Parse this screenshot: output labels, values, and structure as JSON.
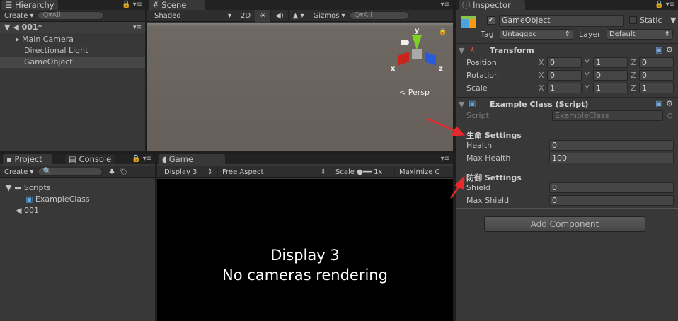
{
  "hierarchy": {
    "tab": "Hierarchy",
    "create": "Create ▾",
    "search": "Q▾All",
    "scene": "001*",
    "items": [
      "Main Camera",
      "Directional Light",
      "GameObject"
    ]
  },
  "scene": {
    "tab": "Scene",
    "shading": "Shaded",
    "mode2d": "2D",
    "gizmos": "Gizmos ▾",
    "search": "Q▾All",
    "persp": "< Persp",
    "axes": {
      "x": "x",
      "y": "y",
      "z": "z"
    }
  },
  "project": {
    "tabs": [
      "Project",
      "Console"
    ],
    "create": "Create ▾",
    "tree": [
      {
        "label": "Scripts"
      },
      {
        "label": "ExampleClass"
      },
      {
        "label": "001"
      }
    ]
  },
  "game": {
    "tab": "Game",
    "display": "Display 3",
    "aspect": "Free Aspect",
    "scale_label": "Scale",
    "scale_value": "1x",
    "maximize": "Maximize C",
    "message_line1": "Display 3",
    "message_line2": "No cameras rendering"
  },
  "inspector": {
    "tab": "Inspector",
    "object_name": "GameObject",
    "static": "Static",
    "tag_label": "Tag",
    "tag": "Untagged",
    "layer_label": "Layer",
    "layer": "Default",
    "transform": {
      "title": "Transform",
      "rows": [
        {
          "label": "Position",
          "x": "0",
          "y": "1",
          "z": "0"
        },
        {
          "label": "Rotation",
          "x": "0",
          "y": "0",
          "z": "0"
        },
        {
          "label": "Scale",
          "x": "1",
          "y": "1",
          "z": "1"
        }
      ],
      "axis_x": "X",
      "axis_y": "Y",
      "axis_z": "Z"
    },
    "script": {
      "title": "Example Class (Script)",
      "script_label": "Script",
      "script_value": "ExampleClass",
      "header1": "生命 Settings",
      "health_label": "Health",
      "health": "0",
      "max_health_label": "Max Health",
      "max_health": "100",
      "header2": "防御 Settings",
      "shield_label": "Shield",
      "shield": "0",
      "max_shield_label": "Max Shield",
      "max_shield": "0"
    },
    "add_component": "Add Component"
  },
  "colors": {
    "accent_arrow": "#e8282a",
    "selection": "#4a4a4a"
  }
}
